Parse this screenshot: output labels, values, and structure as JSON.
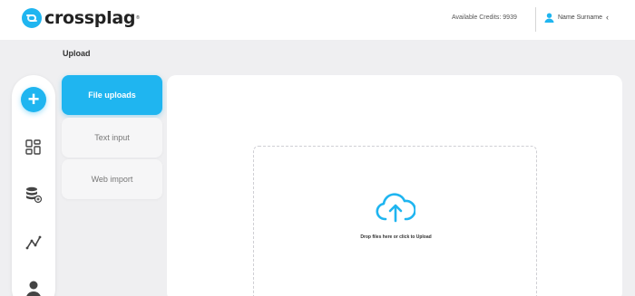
{
  "header": {
    "logo_text": "crossplag",
    "logo_tm": "®",
    "credits": "Available Credits: 9939",
    "user_name": "Name Surname",
    "user_chevron": "‹"
  },
  "page": {
    "title": "Upload"
  },
  "sidebar": {
    "add_symbol": "+",
    "items": [
      {
        "icon": "add-icon"
      },
      {
        "icon": "grid-icon"
      },
      {
        "icon": "database-icon"
      },
      {
        "icon": "analytics-icon"
      },
      {
        "icon": "user-icon"
      }
    ]
  },
  "tabs": [
    {
      "label": "File uploads",
      "active": true
    },
    {
      "label": "Text input",
      "active": false
    },
    {
      "label": "Web import",
      "active": false
    }
  ],
  "upload": {
    "icon": "cloud-upload-icon",
    "text": "Drop files here or click to Upload"
  },
  "colors": {
    "accent": "#1fb5f0",
    "background": "#efeff1"
  }
}
